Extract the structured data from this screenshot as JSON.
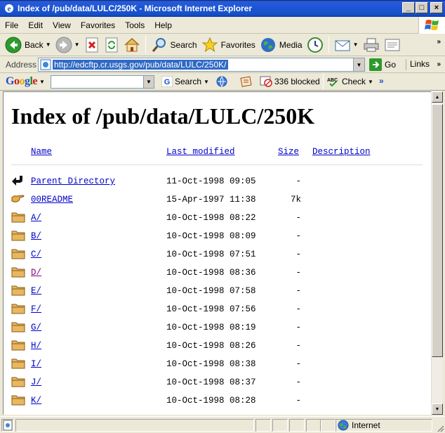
{
  "window": {
    "title": "Index of /pub/data/LULC/250K - Microsoft Internet Explorer",
    "minimize": "_",
    "maximize": "□",
    "close": "×"
  },
  "menu": {
    "items": [
      {
        "label": "File",
        "key": "F"
      },
      {
        "label": "Edit",
        "key": "E"
      },
      {
        "label": "View",
        "key": "V"
      },
      {
        "label": "Favorites",
        "key": "a"
      },
      {
        "label": "Tools",
        "key": "T"
      },
      {
        "label": "Help",
        "key": "H"
      }
    ]
  },
  "toolbar": {
    "back_label": "Back",
    "search_label": "Search",
    "favorites_label": "Favorites",
    "media_label": "Media",
    "chevron": "»"
  },
  "address": {
    "label": "Address",
    "url": "http://edcftp.cr.usgs.gov/pub/data/LULC/250K/",
    "go_label": "Go",
    "links_label": "Links",
    "links_chevron": "»"
  },
  "google_bar": {
    "logo_letters": [
      "G",
      "o",
      "o",
      "g",
      "l",
      "e"
    ],
    "search_label": "Search",
    "blocked_label": "336 blocked",
    "check_label": "Check",
    "chevron": "»"
  },
  "page": {
    "heading": "Index of /pub/data/LULC/250K",
    "columns": {
      "name": "Name",
      "last_modified": "Last modified",
      "size": "Size",
      "description": "Description"
    },
    "rows": [
      {
        "icon": "back-arrow-icon",
        "name": "Parent Directory",
        "modified": "11-Oct-1998 09:05",
        "size": "-",
        "visited": false
      },
      {
        "icon": "pointing-hand-icon",
        "name": "00README",
        "modified": "15-Apr-1997 11:38",
        "size": "7k",
        "visited": false
      },
      {
        "icon": "folder-icon",
        "name": "A/",
        "modified": "10-Oct-1998 08:22",
        "size": "-",
        "visited": false
      },
      {
        "icon": "folder-icon",
        "name": "B/",
        "modified": "10-Oct-1998 08:09",
        "size": "-",
        "visited": false
      },
      {
        "icon": "folder-icon",
        "name": "C/",
        "modified": "10-Oct-1998 07:51",
        "size": "-",
        "visited": false
      },
      {
        "icon": "folder-icon",
        "name": "D/",
        "modified": "10-Oct-1998 08:36",
        "size": "-",
        "visited": true
      },
      {
        "icon": "folder-icon",
        "name": "E/",
        "modified": "10-Oct-1998 07:58",
        "size": "-",
        "visited": false
      },
      {
        "icon": "folder-icon",
        "name": "F/",
        "modified": "10-Oct-1998 07:56",
        "size": "-",
        "visited": false
      },
      {
        "icon": "folder-icon",
        "name": "G/",
        "modified": "10-Oct-1998 08:19",
        "size": "-",
        "visited": false
      },
      {
        "icon": "folder-icon",
        "name": "H/",
        "modified": "10-Oct-1998 08:26",
        "size": "-",
        "visited": false
      },
      {
        "icon": "folder-icon",
        "name": "I/",
        "modified": "10-Oct-1998 08:38",
        "size": "-",
        "visited": false
      },
      {
        "icon": "folder-icon",
        "name": "J/",
        "modified": "10-Oct-1998 08:37",
        "size": "-",
        "visited": false
      },
      {
        "icon": "folder-icon",
        "name": "K/",
        "modified": "10-Oct-1998 08:28",
        "size": "-",
        "visited": false
      }
    ]
  },
  "status": {
    "zone_label": "Internet"
  },
  "colors": {
    "link": "#0000cc",
    "visited_link": "#800080",
    "titlebar": "#1650c8",
    "chrome": "#ece9d8",
    "url_highlight": "#316ac5"
  }
}
